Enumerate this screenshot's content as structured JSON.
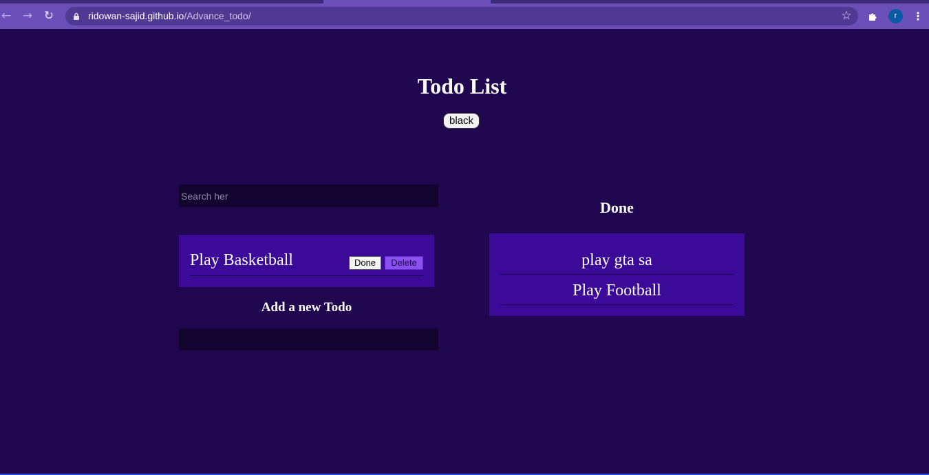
{
  "browser": {
    "url_host": "ridowan-sajid.github.io",
    "url_path": "/Advance_todo/",
    "avatar_letter": "r",
    "back_icon": "arrow-left-icon",
    "forward_icon": "arrow-right-icon",
    "reload_icon": "reload-icon",
    "bookmark_icon": "star-icon",
    "extensions_icon": "puzzle-icon",
    "menu_icon": "kebab-menu-icon"
  },
  "header": {
    "title": "Todo List",
    "theme_button_label": "black"
  },
  "todos": {
    "search_placeholder": "Search her",
    "items": [
      {
        "text": "Play Basketball",
        "done_label": "Done",
        "delete_label": "Delete"
      }
    ],
    "add_heading": "Add a new Todo",
    "add_input_value": ""
  },
  "done": {
    "heading": "Done",
    "items": [
      {
        "text": "play gta sa"
      },
      {
        "text": "Play Football"
      }
    ]
  },
  "colors": {
    "page_background": "#20074f",
    "card_background": "#3b0a98",
    "input_background": "#12042f",
    "delete_button": "#8a4ff0",
    "browser_frame": "#6b4fb8"
  }
}
